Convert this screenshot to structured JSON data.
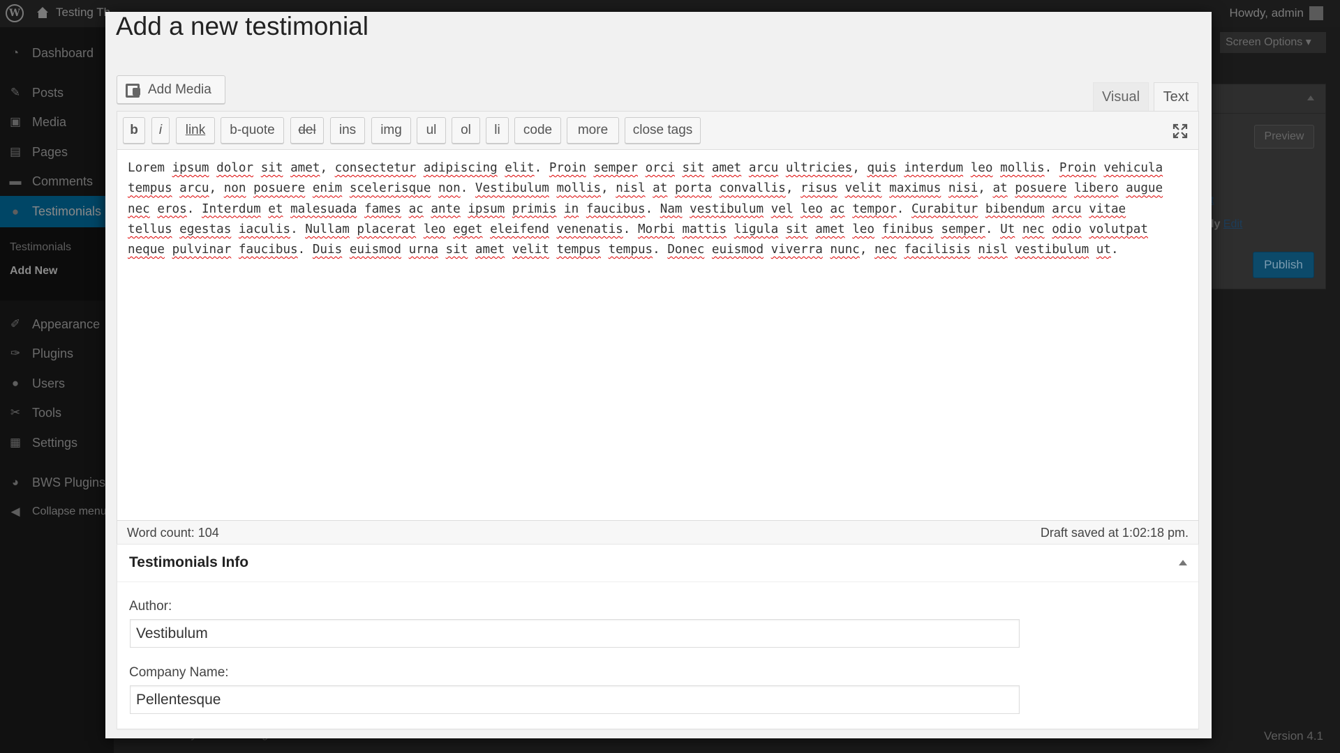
{
  "admin_bar": {
    "site_name": "Testing Th",
    "howdy": "Howdy, admin"
  },
  "sidebar": {
    "items": [
      {
        "label": "Dashboard",
        "icon": "dashboard-icon"
      },
      {
        "label": "Posts",
        "icon": "pin-icon"
      },
      {
        "label": "Media",
        "icon": "media-icon"
      },
      {
        "label": "Pages",
        "icon": "page-icon"
      },
      {
        "label": "Comments",
        "icon": "comment-icon"
      },
      {
        "label": "Testimonials",
        "icon": "testimonial-icon"
      },
      {
        "label": "Appearance",
        "icon": "brush-icon"
      },
      {
        "label": "Plugins",
        "icon": "plug-icon"
      },
      {
        "label": "Users",
        "icon": "user-icon"
      },
      {
        "label": "Tools",
        "icon": "wrench-icon"
      },
      {
        "label": "Settings",
        "icon": "settings-icon"
      },
      {
        "label": "BWS Plugins",
        "icon": "bws-icon"
      },
      {
        "label": "Collapse menu",
        "icon": "collapse-icon"
      }
    ],
    "submenu": {
      "testimonials": "Testimonials",
      "add_new": "Add New"
    }
  },
  "background": {
    "screen_options": "Screen Options",
    "preview": "Preview",
    "link_fragment": "t",
    "visibility_fragment": "ly",
    "edit": "Edit",
    "publish": "Publish",
    "footer": "Thank you for creating with WordPress.",
    "version": "Version 4.1"
  },
  "modal": {
    "title": "Add a new testimonial",
    "add_media": "Add Media",
    "tabs": {
      "visual": "Visual",
      "text": "Text"
    },
    "quicktags": [
      "b",
      "i",
      "link",
      "b-quote",
      "del",
      "ins",
      "img",
      "ul",
      "ol",
      "li",
      "code",
      "more",
      "close tags"
    ],
    "content": "Lorem ipsum dolor sit amet, consectetur adipiscing elit. Proin semper orci sit amet arcu ultricies, quis interdum leo mollis. Proin vehicula tempus arcu, non posuere enim scelerisque non. Vestibulum mollis, nisl at porta convallis, risus velit maximus nisi, at posuere libero augue nec eros. Interdum et malesuada fames ac ante ipsum primis in faucibus. Nam vestibulum vel leo ac tempor. Curabitur bibendum arcu vitae tellus egestas iaculis. Nullam placerat leo eget eleifend venenatis. Morbi mattis ligula sit amet leo finibus semper. Ut nec odio volutpat neque pulvinar faucibus. Duis euismod urna sit amet velit tempus tempus. Donec euismod viverra nunc, nec facilisis nisl vestibulum ut.",
    "content_lines": [
      "Lorem ipsum dolor sit amet, consectetur adipiscing elit. Proin semper orci sit amet arcu ultricies, quis interdum leo mollis. Proin vehicula",
      "tempus arcu, non posuere enim scelerisque non. Vestibulum mollis, nisl at porta convallis, risus velit maximus nisi, at posuere libero augue",
      "nec eros. Interdum et malesuada fames ac ante ipsum primis in faucibus. Nam vestibulum vel leo ac tempor. Curabitur bibendum arcu vitae",
      "tellus egestas iaculis. Nullam placerat leo eget eleifend venenatis. Morbi mattis ligula sit amet leo finibus semper. Ut nec odio volutpat",
      "neque pulvinar faucibus. Duis euismod urna sit amet velit tempus tempus. Donec euismod viverra nunc, nec facilisis nisl vestibulum ut."
    ],
    "word_count": "Word count: 104",
    "draft_saved": "Draft saved at 1:02:18 pm.",
    "info_box": {
      "title": "Testimonials Info",
      "author_label": "Author:",
      "author_value": "Vestibulum",
      "company_label": "Company Name:",
      "company_value": "Pellentesque"
    }
  },
  "colors": {
    "accent": "#0073aa",
    "spellcheck": "#dd0000"
  }
}
